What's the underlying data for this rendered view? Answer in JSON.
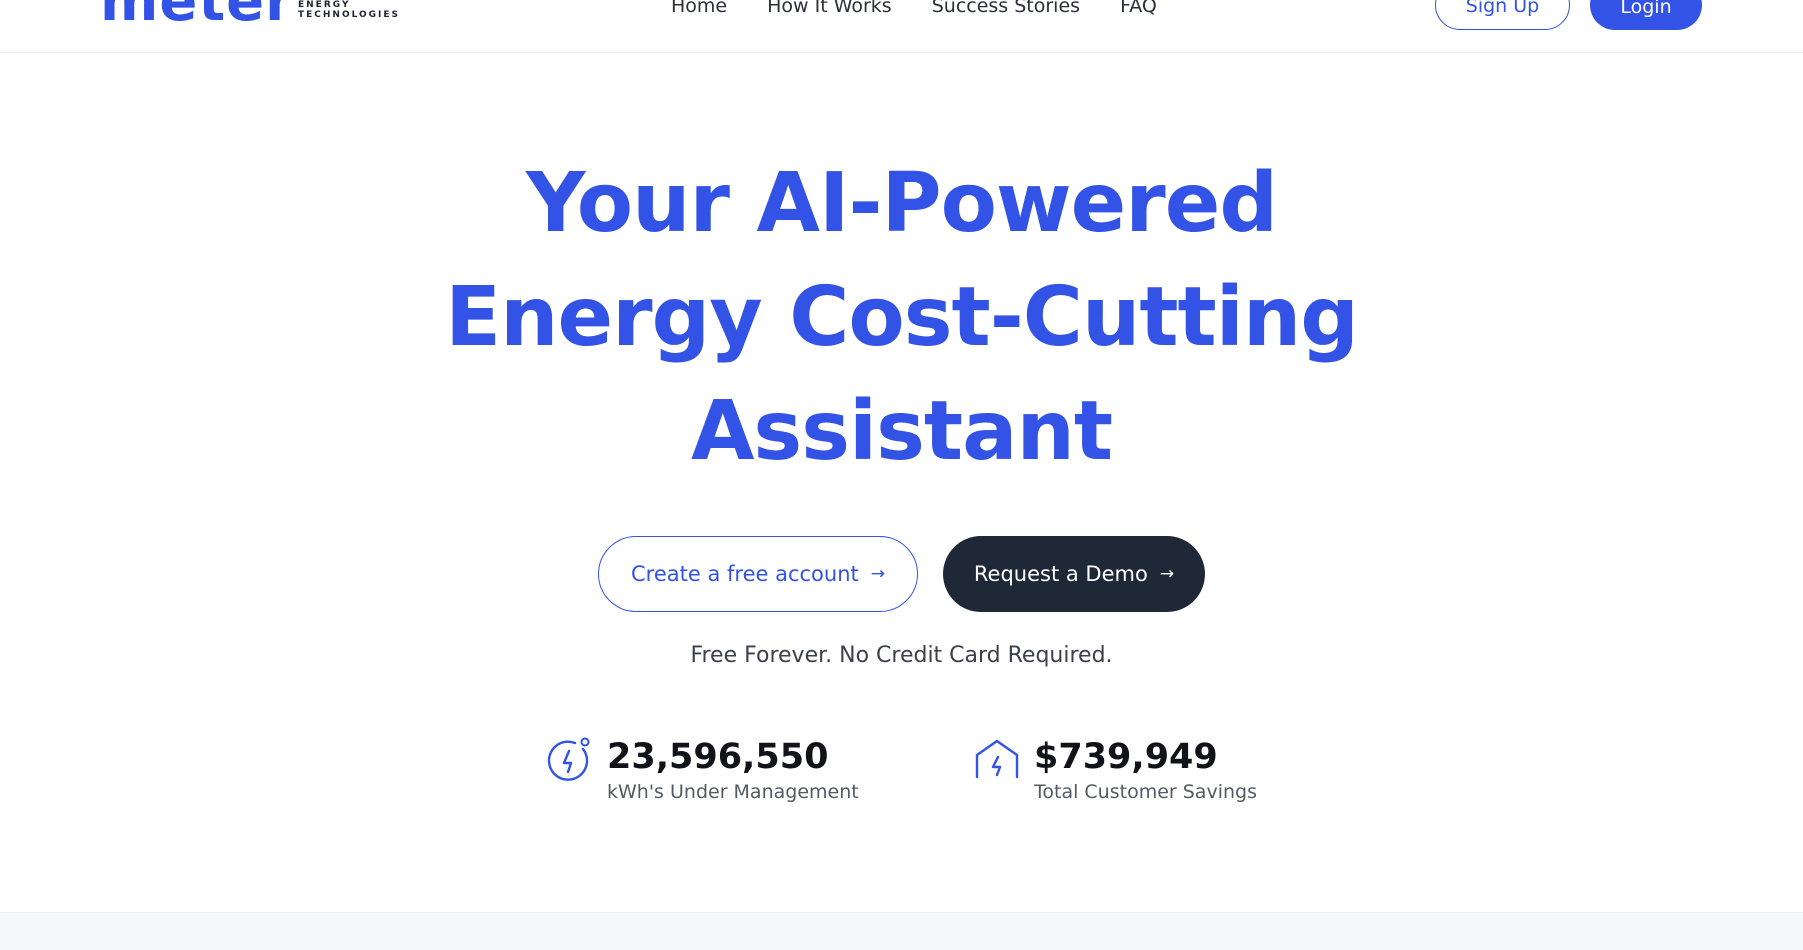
{
  "header": {
    "logo_word": "meter",
    "logo_sub_line1": "ENERGY",
    "logo_sub_line2": "TECHNOLOGIES",
    "nav": [
      "Home",
      "How It Works",
      "Success Stories",
      "FAQ"
    ],
    "signup_label": "Sign Up",
    "login_label": "Login"
  },
  "hero": {
    "title_lines": [
      "Your AI-Powered",
      "Energy Cost-Cutting",
      "Assistant"
    ],
    "cta_primary": "Create a free account",
    "cta_secondary": "Request a Demo",
    "note": "Free Forever. No Credit Card Required."
  },
  "stats": [
    {
      "icon": "lightning-gauge-icon",
      "value": "23,596,550",
      "label": "kWh's Under Management"
    },
    {
      "icon": "house-bolt-icon",
      "value": "$739,949",
      "label": "Total Customer Savings"
    }
  ],
  "colors": {
    "brand_blue": "#3352e6",
    "dark_button": "#1f2836",
    "text_dark": "#111318",
    "text_muted": "#555a66"
  }
}
